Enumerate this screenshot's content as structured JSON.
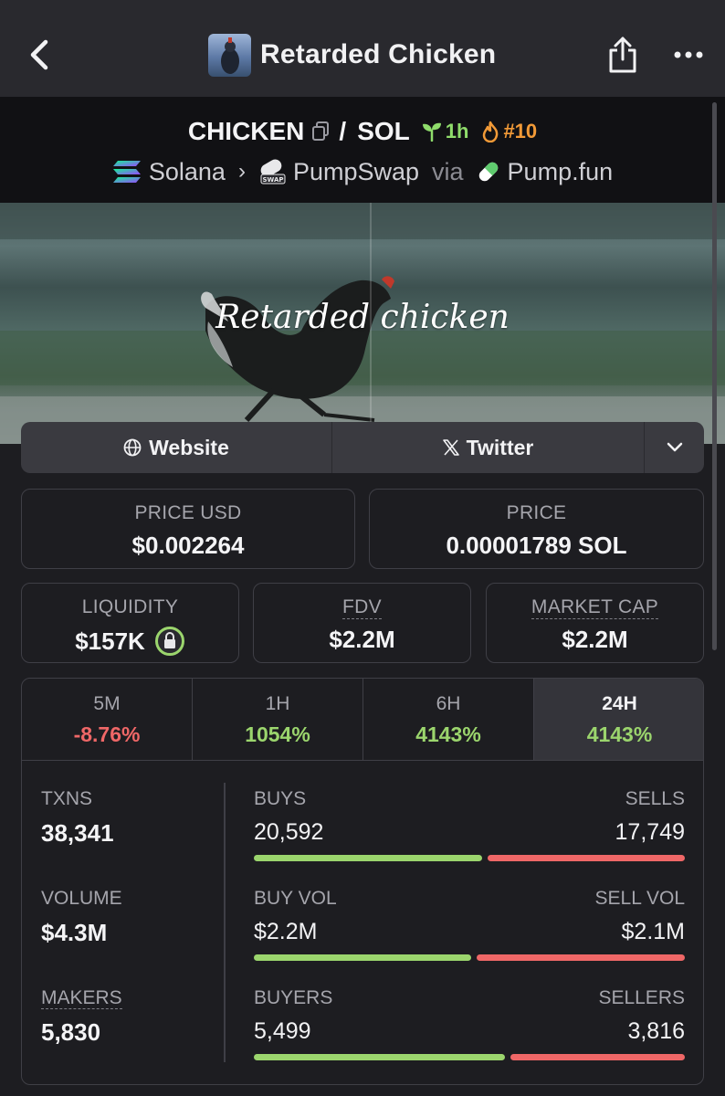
{
  "header": {
    "title": "Retarded Chicken",
    "back_icon": "chevron-left-icon",
    "share_icon": "share-icon",
    "more_icon": "ellipsis-icon"
  },
  "pair": {
    "base": "CHICKEN",
    "separator": "/",
    "quote": "SOL",
    "age": "1h",
    "rank": "#10",
    "chain": "Solana",
    "dex": "PumpSwap",
    "via": "via",
    "launchpad": "Pump.fun"
  },
  "banner": {
    "caption": "Retarded chicken"
  },
  "links": {
    "website": "Website",
    "twitter": "Twitter"
  },
  "stats": {
    "price_usd_label": "PRICE USD",
    "price_usd": "$0.002264",
    "price_label": "PRICE",
    "price_native": "0.00001789 SOL",
    "liquidity_label": "LIQUIDITY",
    "liquidity": "$157K",
    "fdv_label": "FDV",
    "fdv": "$2.2M",
    "mcap_label": "MARKET CAP",
    "mcap": "$2.2M"
  },
  "timeframes": [
    {
      "label": "5M",
      "change": "-8.76%",
      "direction": "down"
    },
    {
      "label": "1H",
      "change": "1054%",
      "direction": "up"
    },
    {
      "label": "6H",
      "change": "4143%",
      "direction": "up"
    },
    {
      "label": "24H",
      "change": "4143%",
      "direction": "up",
      "active": true
    }
  ],
  "metrics": {
    "txns_label": "TXNS",
    "txns": "38,341",
    "volume_label": "VOLUME",
    "volume": "$4.3M",
    "makers_label": "MAKERS",
    "makers": "5,830"
  },
  "splits": {
    "buys_label": "BUYS",
    "sells_label": "SELLS",
    "buys": "20,592",
    "sells": "17,749",
    "buy_vol_label": "BUY VOL",
    "sell_vol_label": "SELL VOL",
    "buy_vol": "$2.2M",
    "sell_vol": "$2.1M",
    "buyers_label": "BUYERS",
    "sellers_label": "SELLERS",
    "buyers": "5,499",
    "sellers": "3,816",
    "buys_n": 20592,
    "sells_n": 17749,
    "buy_vol_n": 2.2,
    "sell_vol_n": 2.1,
    "buyers_n": 5499,
    "sellers_n": 3816
  },
  "colors": {
    "positive": "#9bd56d",
    "negative": "#ef6767",
    "age": "#8fdc6b",
    "rank": "#f29a37"
  }
}
